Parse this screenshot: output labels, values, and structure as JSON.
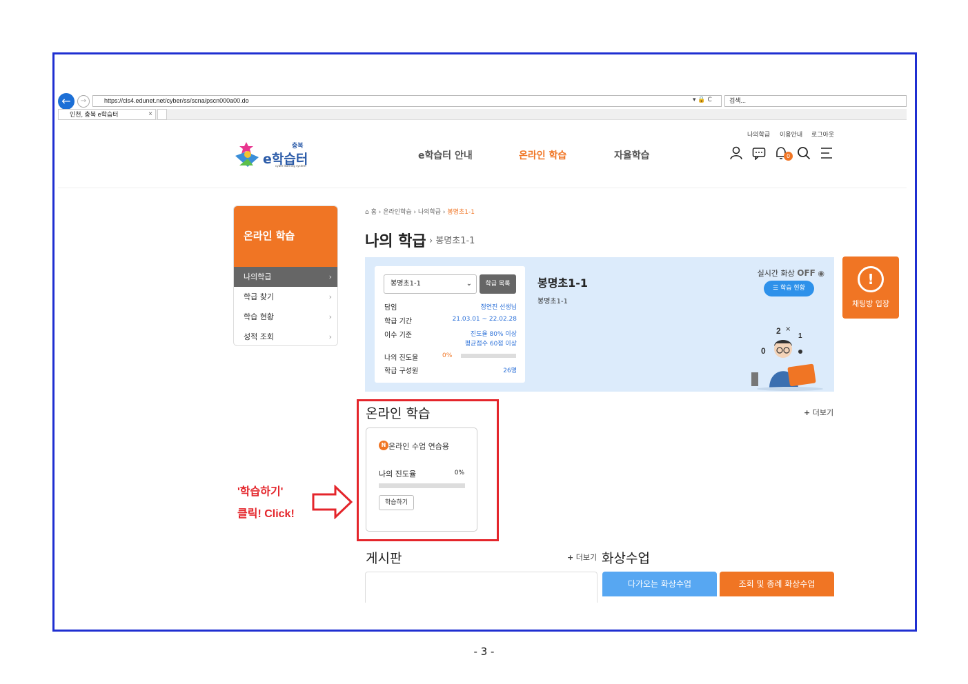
{
  "browser": {
    "url": "https://cls4.edunet.net/cyber/ss/scna/pscn000a00.do",
    "url_tools": "▾ 🔒 C",
    "search_placeholder": "검색...",
    "tab_title": "인천, 충북 e학습터"
  },
  "header": {
    "util_links": [
      "나의학급",
      "이용안내",
      "로그아웃"
    ],
    "logo_region": "충북",
    "logo_text": "e학습터",
    "logo_sub": "cyber learning system",
    "nav": [
      "e학습터 안내",
      "온라인 학습",
      "자율학습"
    ],
    "notification_count": "0"
  },
  "lnb": {
    "title": "온라인 학습",
    "items": [
      "나의학급",
      "학급 찾기",
      "학습 현황",
      "성적 조회"
    ]
  },
  "breadcrumb": [
    "홈",
    "온라인학습",
    "나의학급",
    "봉명초1-1"
  ],
  "page": {
    "title": "나의 학급",
    "subtitle": "봉명초1-1"
  },
  "class_panel": {
    "select_value": "봉명초1-1",
    "list_button": "학급 목록",
    "rows": {
      "teacher_label": "담임",
      "teacher_value": "정연진 선생님",
      "period_label": "학급 기간",
      "period_value": "21.03.01 ~ 22.02.28",
      "criteria_label": "이수 기준",
      "criteria_value1": "진도율 80% 이상",
      "criteria_value2": "평균점수 60점 이상",
      "progress_label": "나의 진도율",
      "progress_value": "0%",
      "members_label": "학급 구성원",
      "members_value": "26명"
    },
    "progress_fraction": 0,
    "class_name": "봉명초1-1",
    "class_sub": "봉명초1-1",
    "realtime_label": "실시간 화상",
    "realtime_state": "OFF",
    "realtime_button": "학습 현황"
  },
  "chat": {
    "label": "채팅방 입장"
  },
  "online_section": {
    "title": "온라인 학습",
    "more": "더보기",
    "course": {
      "badge": "N",
      "name": "온라인 수업 연습용",
      "progress_label": "나의 진도율",
      "progress_value": "0%",
      "progress_fraction": 0,
      "study_button": "학습하기"
    }
  },
  "annotation": {
    "line1": "'학습하기'",
    "line2": "클릭! Click!"
  },
  "board": {
    "title": "게시판",
    "more": "더보기"
  },
  "video": {
    "title": "화상수업",
    "tab_upcoming": "다가오는 화상수업",
    "tab_past": "조회 및 종례 화상수업"
  },
  "colors": {
    "accent": "#f07524",
    "blue": "#2e91ea",
    "panel": "#dcebfb",
    "frame": "#1f2fd1",
    "annotation": "#e4252b"
  },
  "page_number": "- 3 -"
}
